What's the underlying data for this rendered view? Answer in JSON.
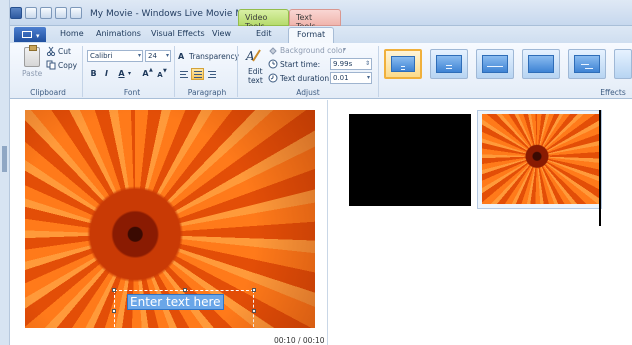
{
  "window": {
    "title": "My Movie - Windows Live Movie Maker",
    "context_tabs": [
      "Video Tools",
      "Text Tools"
    ]
  },
  "tabs": [
    "Home",
    "Animations",
    "Visual Effects",
    "View",
    "Edit",
    "Format"
  ],
  "active_tab": "Format",
  "ribbon": {
    "clipboard": {
      "paste": "Paste",
      "cut": "Cut",
      "copy": "Copy",
      "label": "Clipboard"
    },
    "font": {
      "family": "Calibri",
      "size": "24",
      "bold": "B",
      "italic": "I",
      "color": "A",
      "grow": "A",
      "shrink": "A",
      "label": "Font"
    },
    "paragraph": {
      "transparency": "Transparency",
      "label": "Paragraph"
    },
    "adjust": {
      "edit_text_line1": "Edit",
      "edit_text_line2": "text",
      "background_color": "Background color",
      "start_time_label": "Start time:",
      "start_time_value": "9.99s",
      "duration_label": "Text duration:",
      "duration_value": "0.01",
      "label": "Adjust"
    },
    "effects": {
      "label": "Effects"
    }
  },
  "preview": {
    "caption": "Enter text here",
    "timecode": "00:10 / 00:10"
  },
  "colors": {
    "accent": "#1f4f9f",
    "selection": "#6aa6e8",
    "highlight": "#f7c45a",
    "video_tools": "#b6db6c",
    "text_tools": "#f0b5ad"
  }
}
